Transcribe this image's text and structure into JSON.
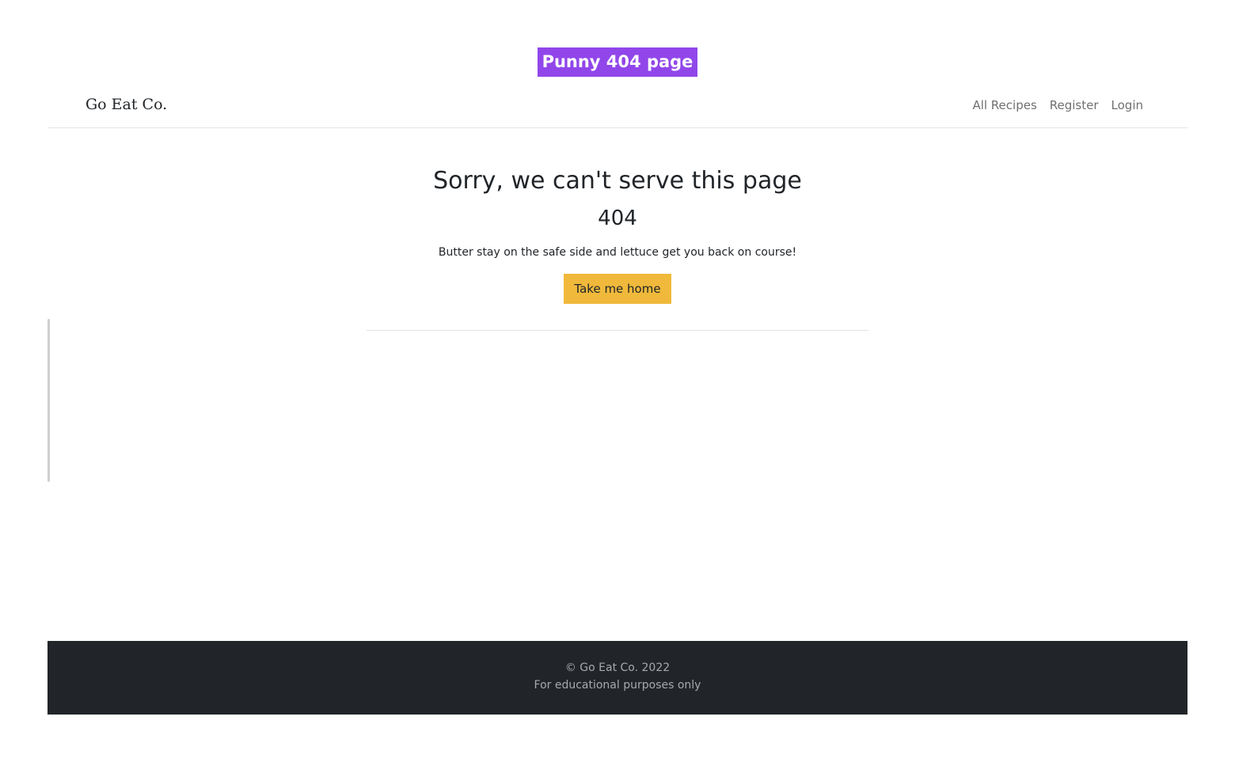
{
  "caption": "Punny 404 page",
  "navbar": {
    "brand": "Go Eat Co.",
    "links": [
      {
        "label": "All Recipes"
      },
      {
        "label": "Register"
      },
      {
        "label": "Login"
      }
    ]
  },
  "main": {
    "title": "Sorry, we can't serve this page",
    "code": "404",
    "message": "Butter stay on the safe side and lettuce get you back on course!",
    "button_label": "Take me home"
  },
  "footer": {
    "copyright": "© Go Eat Co. 2022",
    "note": "For educational purposes only"
  },
  "colors": {
    "caption_bg": "#9146ea",
    "button_bg": "#f0b93b",
    "footer_bg": "#212529"
  }
}
